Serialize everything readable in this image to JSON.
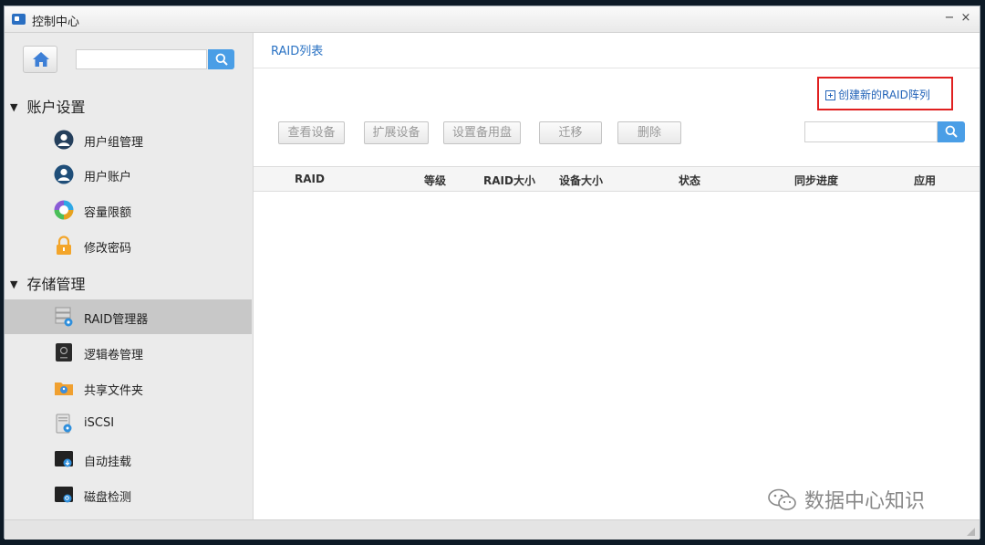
{
  "window": {
    "title": "控制中心",
    "minimize_glyph": "−",
    "close_glyph": "×"
  },
  "sidebar": {
    "search": {
      "value": "",
      "placeholder": ""
    },
    "sections": [
      {
        "label": "账户设置",
        "items": [
          {
            "label": "用户组管理",
            "icon": "user-group-icon"
          },
          {
            "label": "用户账户",
            "icon": "user-account-icon"
          },
          {
            "label": "容量限额",
            "icon": "quota-icon"
          },
          {
            "label": "修改密码",
            "icon": "lock-icon"
          }
        ]
      },
      {
        "label": "存储管理",
        "items": [
          {
            "label": "RAID管理器",
            "icon": "raid-manager-icon",
            "selected": true
          },
          {
            "label": "逻辑卷管理",
            "icon": "logical-volume-icon"
          },
          {
            "label": "共享文件夹",
            "icon": "shared-folder-icon"
          },
          {
            "label": "iSCSI",
            "icon": "iscsi-icon"
          },
          {
            "label": "自动挂载",
            "icon": "auto-mount-icon"
          },
          {
            "label": "磁盘检测",
            "icon": "disk-check-icon"
          }
        ]
      }
    ]
  },
  "main": {
    "tab_title": "RAID列表",
    "create_label": "创建新的RAID阵列",
    "toolbar": {
      "buttons": [
        {
          "label": "查看设备",
          "enabled": false
        },
        {
          "label": "扩展设备",
          "enabled": false
        },
        {
          "label": "设置备用盘",
          "enabled": false
        },
        {
          "label": "迁移",
          "enabled": false
        },
        {
          "label": "删除",
          "enabled": false
        }
      ],
      "search": {
        "value": "",
        "placeholder": ""
      }
    },
    "table": {
      "columns": [
        "RAID",
        "等级",
        "RAID大小",
        "设备大小",
        "状态",
        "同步进度",
        "应用"
      ],
      "rows": []
    }
  },
  "watermark": {
    "text": "数据中心知识"
  },
  "colors": {
    "accent": "#4a9ee6",
    "link": "#2263b8",
    "highlight_box": "#e02020",
    "selected_row": "#c8c8c8"
  }
}
